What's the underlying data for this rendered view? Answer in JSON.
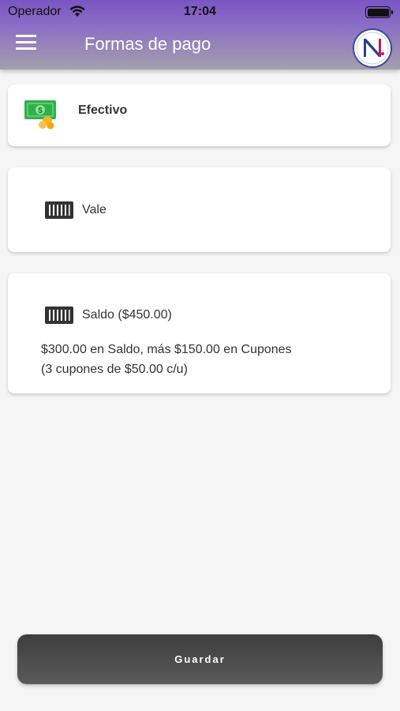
{
  "status_bar": {
    "carrier": "Operador",
    "time": "17:04"
  },
  "header": {
    "title": "Formas de pago",
    "logo_letter": "N"
  },
  "payment_methods": [
    {
      "label": "Efectivo",
      "icon": "cash-icon"
    },
    {
      "label": "Vale",
      "icon": "barcode-icon"
    },
    {
      "label": "Saldo ($450.00)",
      "icon": "barcode-icon",
      "description_line1": "$300.00 en Saldo, más $150.00 en Cupones",
      "description_line2": "(3 cupones de $50.00 c/u)"
    }
  ],
  "footer": {
    "save_label": "Guardar"
  },
  "colors": {
    "header_top": "#7a55c2",
    "header_bottom": "#a4a0ac",
    "cash_green": "#2fb24a",
    "coin_gold": "#f5b423",
    "button_dark": "#4a4a4a"
  }
}
